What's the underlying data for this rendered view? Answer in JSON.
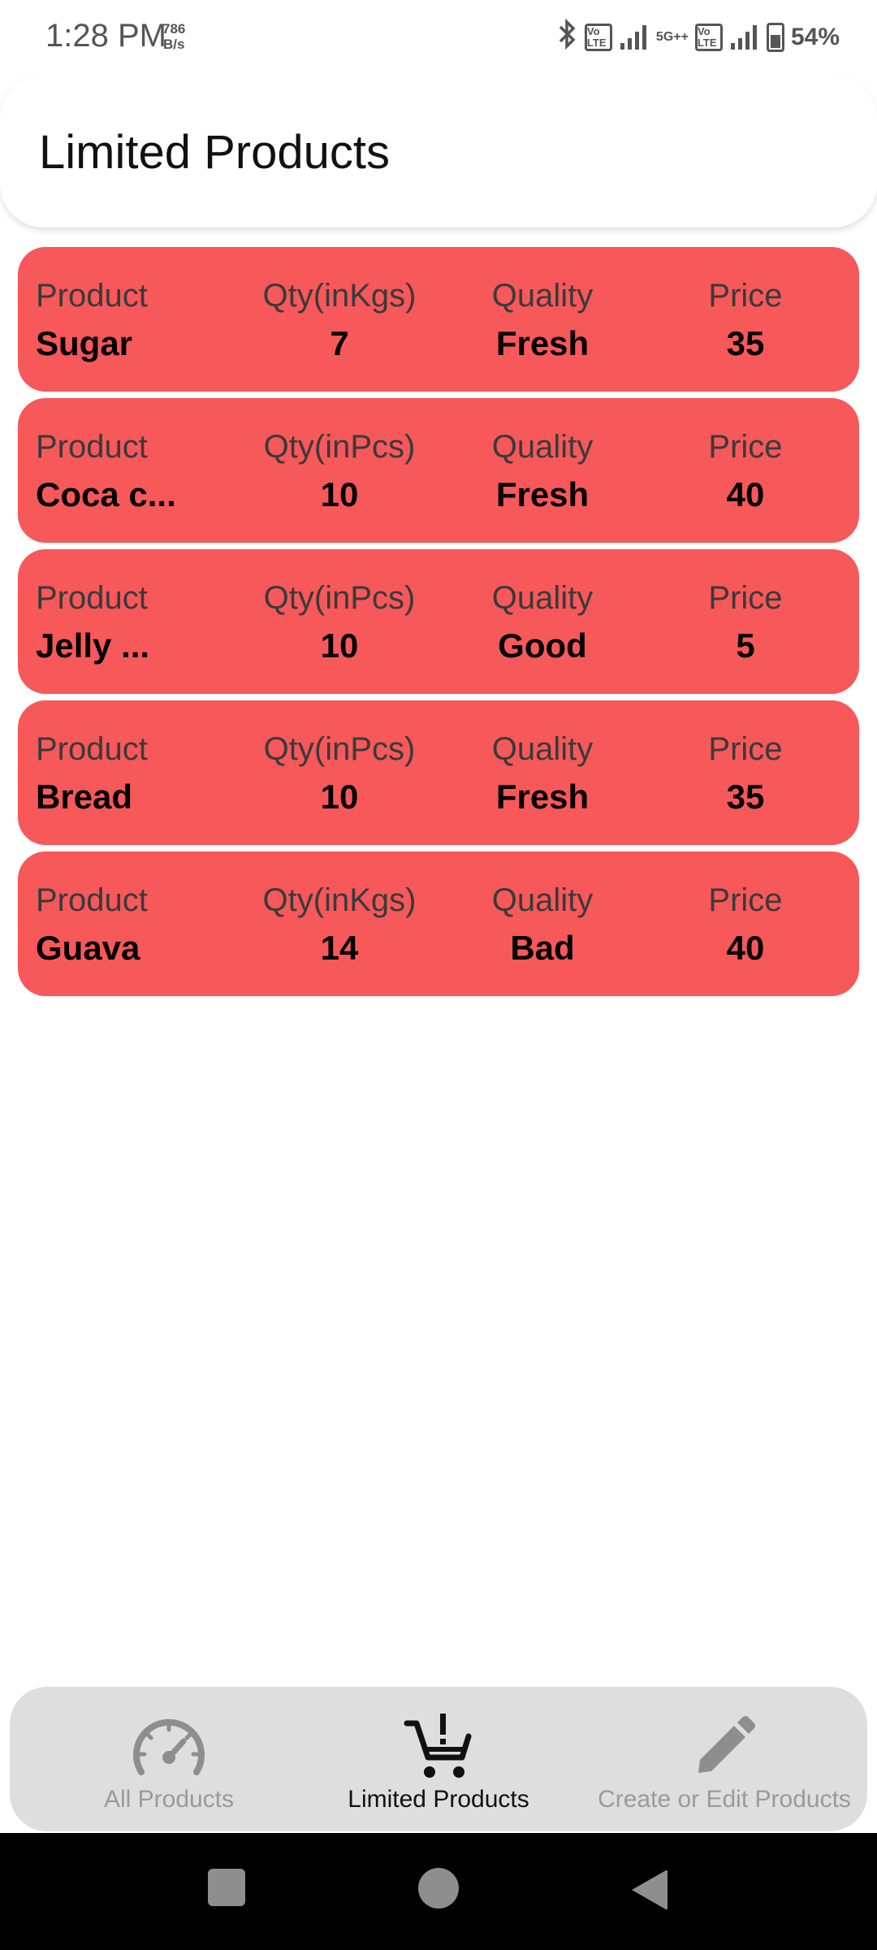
{
  "status": {
    "time": "1:28 PM",
    "speed_value": "786",
    "speed_unit": "B/s",
    "volte1": "Vo LTE",
    "net": "5G++",
    "volte2": "Vo LTE",
    "battery": "54%"
  },
  "header": {
    "title": "Limited Products"
  },
  "products": [
    {
      "product_label": "Product",
      "product": "Sugar",
      "qty_label": "Qty(inKgs)",
      "qty": "7",
      "quality_label": "Quality",
      "quality": "Fresh",
      "price_label": "Price",
      "price": "35"
    },
    {
      "product_label": "Product",
      "product": "Coca c...",
      "qty_label": "Qty(inPcs)",
      "qty": "10",
      "quality_label": "Quality",
      "quality": "Fresh",
      "price_label": "Price",
      "price": "40"
    },
    {
      "product_label": "Product",
      "product": "Jelly ...",
      "qty_label": "Qty(inPcs)",
      "qty": "10",
      "quality_label": "Quality",
      "quality": "Good",
      "price_label": "Price",
      "price": "5"
    },
    {
      "product_label": "Product",
      "product": "Bread",
      "qty_label": "Qty(inPcs)",
      "qty": "10",
      "quality_label": "Quality",
      "quality": "Fresh",
      "price_label": "Price",
      "price": "35"
    },
    {
      "product_label": "Product",
      "product": "Guava",
      "qty_label": "Qty(inKgs)",
      "qty": "14",
      "quality_label": "Quality",
      "quality": "Bad",
      "price_label": "Price",
      "price": "40"
    }
  ],
  "nav": {
    "items": [
      {
        "label": "All Products",
        "icon": "speedometer-icon",
        "active": false
      },
      {
        "label": "Limited Products",
        "icon": "cart-alert-icon",
        "active": true
      },
      {
        "label": "Create or Edit Products",
        "icon": "pencil-icon",
        "active": false
      }
    ]
  },
  "colors": {
    "card": "#f7585a",
    "nav_bg": "#dedede",
    "active_text": "#111111",
    "inactive_text": "#9a9a9a"
  }
}
